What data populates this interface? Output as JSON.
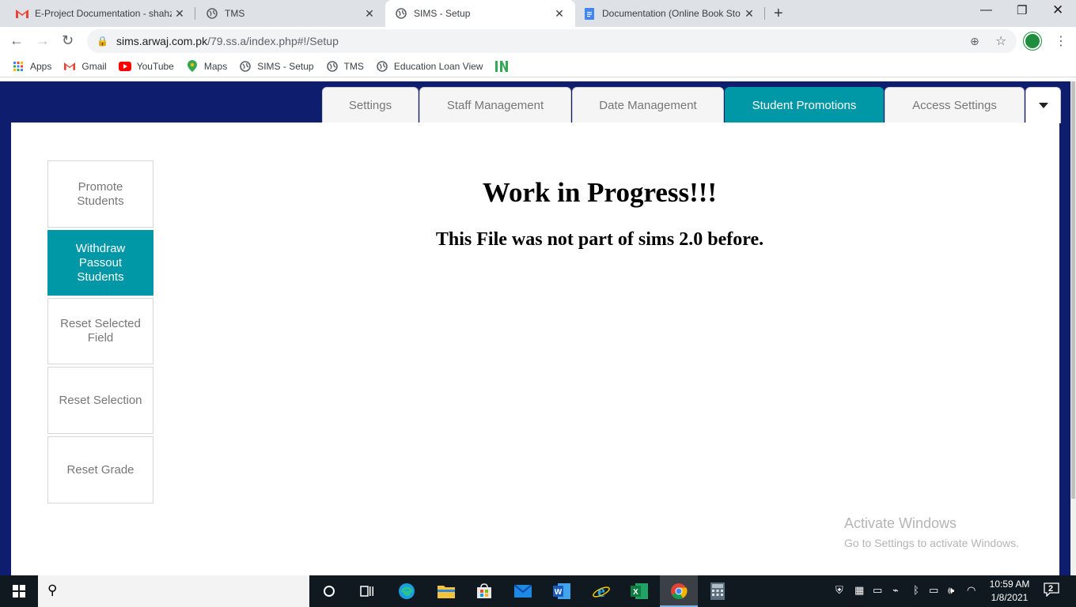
{
  "browser": {
    "tabs": [
      {
        "title": "E-Project Documentation - shahz",
        "icon": "gmail-icon",
        "active": false
      },
      {
        "title": "TMS",
        "icon": "globe-icon",
        "active": false
      },
      {
        "title": "SIMS - Setup",
        "icon": "globe-icon",
        "active": true
      },
      {
        "title": "Documentation (Online Book Sto",
        "icon": "docs-icon",
        "active": false
      }
    ],
    "new_tab_label": "+",
    "url_host": "sims.arwaj.com.pk",
    "url_path": "/79.ss.a/index.php#!/Setup",
    "bookmarks": [
      {
        "label": "Apps",
        "icon": "apps-grid-icon"
      },
      {
        "label": "Gmail",
        "icon": "gmail-icon"
      },
      {
        "label": "YouTube",
        "icon": "youtube-icon"
      },
      {
        "label": "Maps",
        "icon": "maps-pin-icon"
      },
      {
        "label": "SIMS - Setup",
        "icon": "globe-icon"
      },
      {
        "label": "TMS",
        "icon": "globe-icon"
      },
      {
        "label": "Education Loan View",
        "icon": "globe-icon"
      },
      {
        "label": "",
        "icon": "in-logo-icon"
      }
    ]
  },
  "top_tabs": [
    {
      "label": "Settings"
    },
    {
      "label": "Staff Management"
    },
    {
      "label": "Date Management"
    },
    {
      "label": "Student Promotions",
      "active": true
    },
    {
      "label": "Access Settings"
    }
  ],
  "sidebar": {
    "items": [
      {
        "label": "Promote Students"
      },
      {
        "label": "Withdraw Passout Students",
        "active": true
      },
      {
        "label": "Reset Selected Field"
      },
      {
        "label": "Reset Selection"
      },
      {
        "label": "Reset Grade"
      }
    ]
  },
  "main": {
    "heading": "Work in Progress!!!",
    "subheading": "This File was not part of sims 2.0 before."
  },
  "watermark": {
    "title": "Activate Windows",
    "subtitle": "Go to Settings to activate Windows."
  },
  "taskbar": {
    "time": "10:59 AM",
    "date": "1/8/2021",
    "notification_count": "2"
  },
  "colors": {
    "accent": "#0097a7",
    "page_background": "#0f1d6e",
    "taskbar": "#101820"
  }
}
